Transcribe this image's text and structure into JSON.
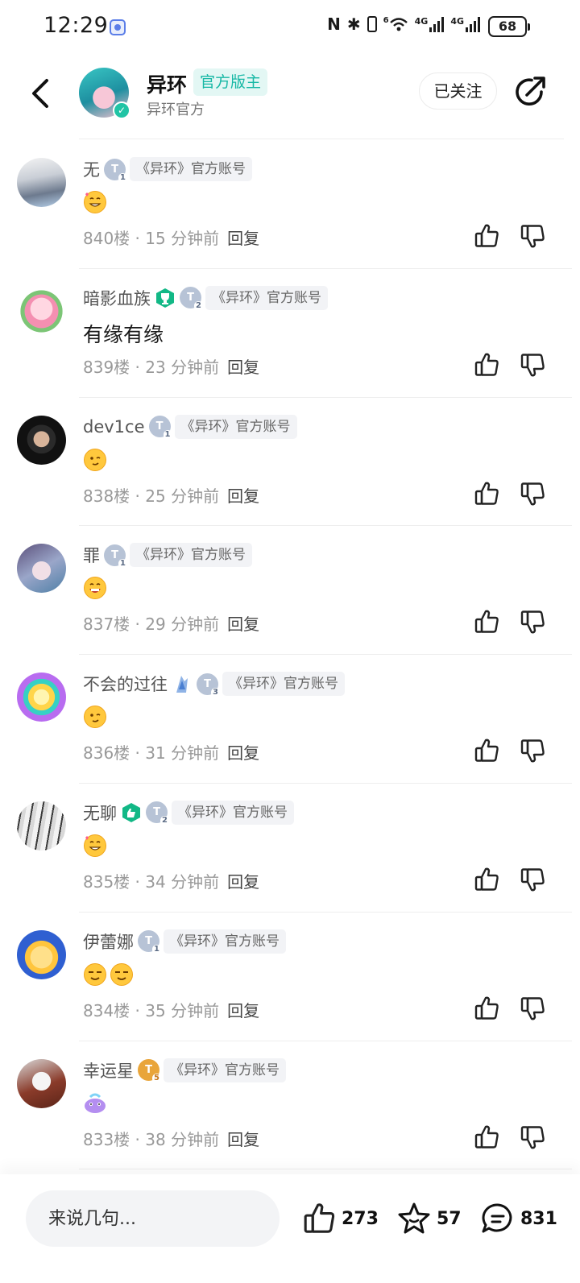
{
  "status_bar": {
    "time": "12:29",
    "net1": "6",
    "net2": "4G",
    "net3": "4G",
    "battery": "68"
  },
  "header": {
    "name": "异环",
    "role_badge": "官方版主",
    "subtitle": "异环官方",
    "follow_label": "已关注"
  },
  "comments": [
    {
      "name": "无",
      "level": "1",
      "tag": "《异环》官方账号",
      "content_emoji": [
        "heart-smile"
      ],
      "floor": "840楼",
      "time": "15 分钟前",
      "reply": "回复"
    },
    {
      "name": "暗影血族",
      "level": "2",
      "tag": "《异环》官方账号",
      "content_text": "有缘有缘",
      "floor": "839楼",
      "time": "23 分钟前",
      "reply": "回复"
    },
    {
      "name": "dev1ce",
      "level": "1",
      "tag": "《异环》官方账号",
      "content_emoji": [
        "wink"
      ],
      "floor": "838楼",
      "time": "25 分钟前",
      "reply": "回复"
    },
    {
      "name": "罪",
      "level": "1",
      "tag": "《异环》官方账号",
      "content_emoji": [
        "grin"
      ],
      "floor": "837楼",
      "time": "29 分钟前",
      "reply": "回复"
    },
    {
      "name": "不会的过往",
      "level": "3",
      "tag": "《异环》官方账号",
      "content_emoji": [
        "wink"
      ],
      "floor": "836楼",
      "time": "31 分钟前",
      "reply": "回复"
    },
    {
      "name": "无聊",
      "level": "2",
      "tag": "《异环》官方账号",
      "content_emoji": [
        "heart-smile"
      ],
      "floor": "835楼",
      "time": "34 分钟前",
      "reply": "回复"
    },
    {
      "name": "伊蕾娜",
      "level": "1",
      "tag": "《异环》官方账号",
      "content_emoji": [
        "smug",
        "smug"
      ],
      "floor": "834楼",
      "time": "35 分钟前",
      "reply": "回复"
    },
    {
      "name": "幸运星",
      "level": "5",
      "tag": "《异环》官方账号",
      "content_emoji": [
        "purple-creature"
      ],
      "floor": "833楼",
      "time": "38 分钟前",
      "reply": "回复"
    }
  ],
  "bottom_bar": {
    "input_placeholder": "来说几句...",
    "likes": "273",
    "favorites": "57",
    "comments": "831"
  },
  "colors": {
    "accent": "#17b8a5",
    "level_badge": "#b7c3d6",
    "level_badge_gold": "#e9a53a",
    "divider": "#eeeeee"
  }
}
